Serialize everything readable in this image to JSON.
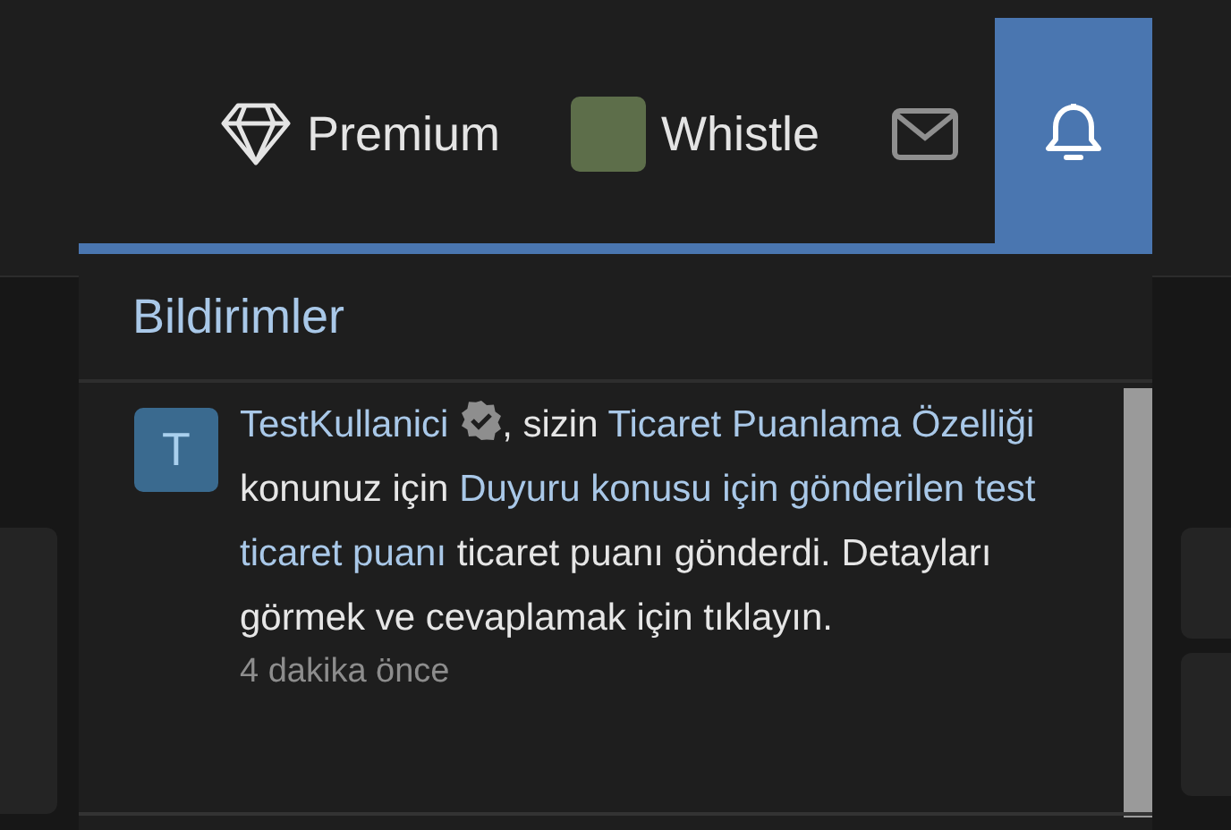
{
  "navbar": [
    {
      "kind": "premium",
      "label": "Premium"
    },
    {
      "kind": "user",
      "label": "Whistle"
    },
    {
      "kind": "inbox"
    },
    {
      "kind": "alerts",
      "selected": true
    }
  ],
  "notifications_menu": {
    "title": "Bildirimler",
    "items": [
      {
        "avatar_letter": "T",
        "verified": true,
        "segments": [
          {
            "kind": "link",
            "text": "TestKullanici"
          },
          {
            "kind": "badge"
          },
          {
            "kind": "text",
            "text": ", sizin "
          },
          {
            "kind": "link",
            "text": "Ticaret Puanlama Özelliği"
          },
          {
            "kind": "text",
            "text": " konunuz için "
          },
          {
            "kind": "link",
            "text": "Duyuru konusu için gönderilen test ticaret puanı"
          },
          {
            "kind": "text",
            "text": " ticaret puanı gönderdi. Detayları görmek ve cevaplamak için tıklayın."
          }
        ],
        "time": "4 dakika önce"
      }
    ]
  }
}
